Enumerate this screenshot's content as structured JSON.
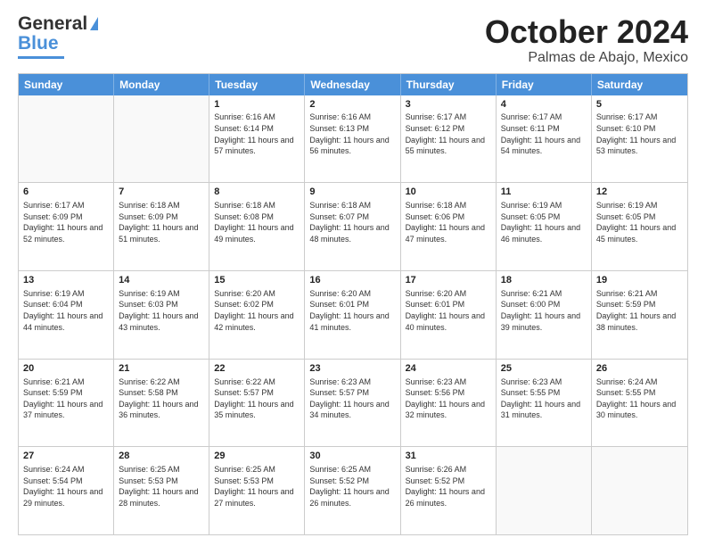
{
  "logo": {
    "part1": "General",
    "part2": "Blue"
  },
  "header": {
    "month": "October 2024",
    "location": "Palmas de Abajo, Mexico"
  },
  "weekdays": [
    "Sunday",
    "Monday",
    "Tuesday",
    "Wednesday",
    "Thursday",
    "Friday",
    "Saturday"
  ],
  "rows": [
    [
      {
        "day": "",
        "text": ""
      },
      {
        "day": "",
        "text": ""
      },
      {
        "day": "1",
        "text": "Sunrise: 6:16 AM\nSunset: 6:14 PM\nDaylight: 11 hours and 57 minutes."
      },
      {
        "day": "2",
        "text": "Sunrise: 6:16 AM\nSunset: 6:13 PM\nDaylight: 11 hours and 56 minutes."
      },
      {
        "day": "3",
        "text": "Sunrise: 6:17 AM\nSunset: 6:12 PM\nDaylight: 11 hours and 55 minutes."
      },
      {
        "day": "4",
        "text": "Sunrise: 6:17 AM\nSunset: 6:11 PM\nDaylight: 11 hours and 54 minutes."
      },
      {
        "day": "5",
        "text": "Sunrise: 6:17 AM\nSunset: 6:10 PM\nDaylight: 11 hours and 53 minutes."
      }
    ],
    [
      {
        "day": "6",
        "text": "Sunrise: 6:17 AM\nSunset: 6:09 PM\nDaylight: 11 hours and 52 minutes."
      },
      {
        "day": "7",
        "text": "Sunrise: 6:18 AM\nSunset: 6:09 PM\nDaylight: 11 hours and 51 minutes."
      },
      {
        "day": "8",
        "text": "Sunrise: 6:18 AM\nSunset: 6:08 PM\nDaylight: 11 hours and 49 minutes."
      },
      {
        "day": "9",
        "text": "Sunrise: 6:18 AM\nSunset: 6:07 PM\nDaylight: 11 hours and 48 minutes."
      },
      {
        "day": "10",
        "text": "Sunrise: 6:18 AM\nSunset: 6:06 PM\nDaylight: 11 hours and 47 minutes."
      },
      {
        "day": "11",
        "text": "Sunrise: 6:19 AM\nSunset: 6:05 PM\nDaylight: 11 hours and 46 minutes."
      },
      {
        "day": "12",
        "text": "Sunrise: 6:19 AM\nSunset: 6:05 PM\nDaylight: 11 hours and 45 minutes."
      }
    ],
    [
      {
        "day": "13",
        "text": "Sunrise: 6:19 AM\nSunset: 6:04 PM\nDaylight: 11 hours and 44 minutes."
      },
      {
        "day": "14",
        "text": "Sunrise: 6:19 AM\nSunset: 6:03 PM\nDaylight: 11 hours and 43 minutes."
      },
      {
        "day": "15",
        "text": "Sunrise: 6:20 AM\nSunset: 6:02 PM\nDaylight: 11 hours and 42 minutes."
      },
      {
        "day": "16",
        "text": "Sunrise: 6:20 AM\nSunset: 6:01 PM\nDaylight: 11 hours and 41 minutes."
      },
      {
        "day": "17",
        "text": "Sunrise: 6:20 AM\nSunset: 6:01 PM\nDaylight: 11 hours and 40 minutes."
      },
      {
        "day": "18",
        "text": "Sunrise: 6:21 AM\nSunset: 6:00 PM\nDaylight: 11 hours and 39 minutes."
      },
      {
        "day": "19",
        "text": "Sunrise: 6:21 AM\nSunset: 5:59 PM\nDaylight: 11 hours and 38 minutes."
      }
    ],
    [
      {
        "day": "20",
        "text": "Sunrise: 6:21 AM\nSunset: 5:59 PM\nDaylight: 11 hours and 37 minutes."
      },
      {
        "day": "21",
        "text": "Sunrise: 6:22 AM\nSunset: 5:58 PM\nDaylight: 11 hours and 36 minutes."
      },
      {
        "day": "22",
        "text": "Sunrise: 6:22 AM\nSunset: 5:57 PM\nDaylight: 11 hours and 35 minutes."
      },
      {
        "day": "23",
        "text": "Sunrise: 6:23 AM\nSunset: 5:57 PM\nDaylight: 11 hours and 34 minutes."
      },
      {
        "day": "24",
        "text": "Sunrise: 6:23 AM\nSunset: 5:56 PM\nDaylight: 11 hours and 32 minutes."
      },
      {
        "day": "25",
        "text": "Sunrise: 6:23 AM\nSunset: 5:55 PM\nDaylight: 11 hours and 31 minutes."
      },
      {
        "day": "26",
        "text": "Sunrise: 6:24 AM\nSunset: 5:55 PM\nDaylight: 11 hours and 30 minutes."
      }
    ],
    [
      {
        "day": "27",
        "text": "Sunrise: 6:24 AM\nSunset: 5:54 PM\nDaylight: 11 hours and 29 minutes."
      },
      {
        "day": "28",
        "text": "Sunrise: 6:25 AM\nSunset: 5:53 PM\nDaylight: 11 hours and 28 minutes."
      },
      {
        "day": "29",
        "text": "Sunrise: 6:25 AM\nSunset: 5:53 PM\nDaylight: 11 hours and 27 minutes."
      },
      {
        "day": "30",
        "text": "Sunrise: 6:25 AM\nSunset: 5:52 PM\nDaylight: 11 hours and 26 minutes."
      },
      {
        "day": "31",
        "text": "Sunrise: 6:26 AM\nSunset: 5:52 PM\nDaylight: 11 hours and 26 minutes."
      },
      {
        "day": "",
        "text": ""
      },
      {
        "day": "",
        "text": ""
      }
    ]
  ]
}
